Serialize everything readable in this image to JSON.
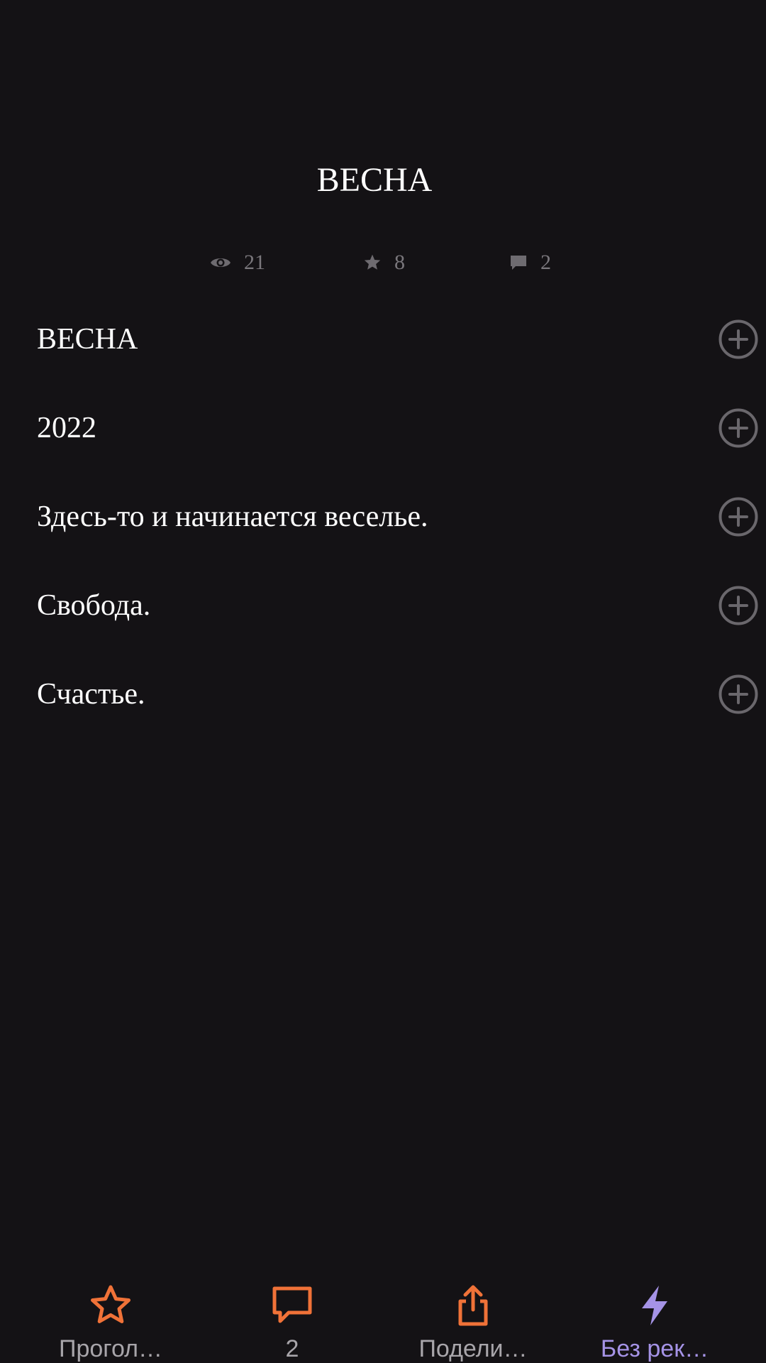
{
  "article": {
    "title": "ВЕСНА"
  },
  "stats": {
    "views": "21",
    "stars": "8",
    "comments": "2",
    "icons": [
      "eye-icon",
      "star-icon",
      "comment-icon"
    ]
  },
  "lines": [
    {
      "text": "ВЕСНА",
      "action_icon": "plus-circle-icon"
    },
    {
      "text": "2022",
      "action_icon": "plus-circle-icon"
    },
    {
      "text": "Здесь-то и начинается веселье.",
      "action_icon": "plus-circle-icon"
    },
    {
      "text": "Свобода.",
      "action_icon": "plus-circle-icon"
    },
    {
      "text": "Счастье.",
      "action_icon": "plus-circle-icon"
    }
  ],
  "tabbar": {
    "vote": {
      "label": "Прогол…",
      "icon": "star-outline-icon"
    },
    "comments": {
      "label": "2",
      "icon": "speech-bubble-icon"
    },
    "share": {
      "label": "Подели…",
      "icon": "share-icon"
    },
    "boost": {
      "label": "Без рек…",
      "icon": "lightning-icon"
    }
  },
  "colors": {
    "background": "#141215",
    "text": "#ffffff",
    "muted": "#7a777c",
    "accent_orange": "#f07238",
    "accent_purple": "#a593e6",
    "tab_label": "#a8a5aa"
  }
}
